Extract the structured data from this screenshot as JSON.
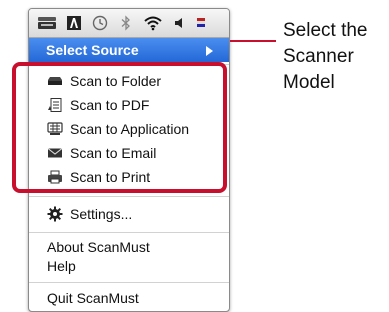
{
  "menu": {
    "selected_item": "Select Source",
    "scan_items": [
      {
        "label": "Scan to Folder",
        "icon": "folder-icon"
      },
      {
        "label": "Scan to PDF",
        "icon": "pdf-document-icon"
      },
      {
        "label": "Scan to Application",
        "icon": "application-icon"
      },
      {
        "label": "Scan to Email",
        "icon": "envelope-icon"
      },
      {
        "label": "Scan to Print",
        "icon": "printer-icon"
      }
    ],
    "settings": "Settings...",
    "about": "About ScanMust",
    "help": "Help",
    "quit": "Quit ScanMust"
  },
  "menubar_icons": [
    "scanner-icon",
    "adobe-icon",
    "clock-icon",
    "bluetooth-icon",
    "wifi-icon",
    "volume-icon"
  ],
  "callout": {
    "lines": [
      "Select the",
      "Scanner",
      "Model"
    ]
  },
  "colors": {
    "selection": "#2f78e4",
    "annotation": "#c8102e"
  }
}
